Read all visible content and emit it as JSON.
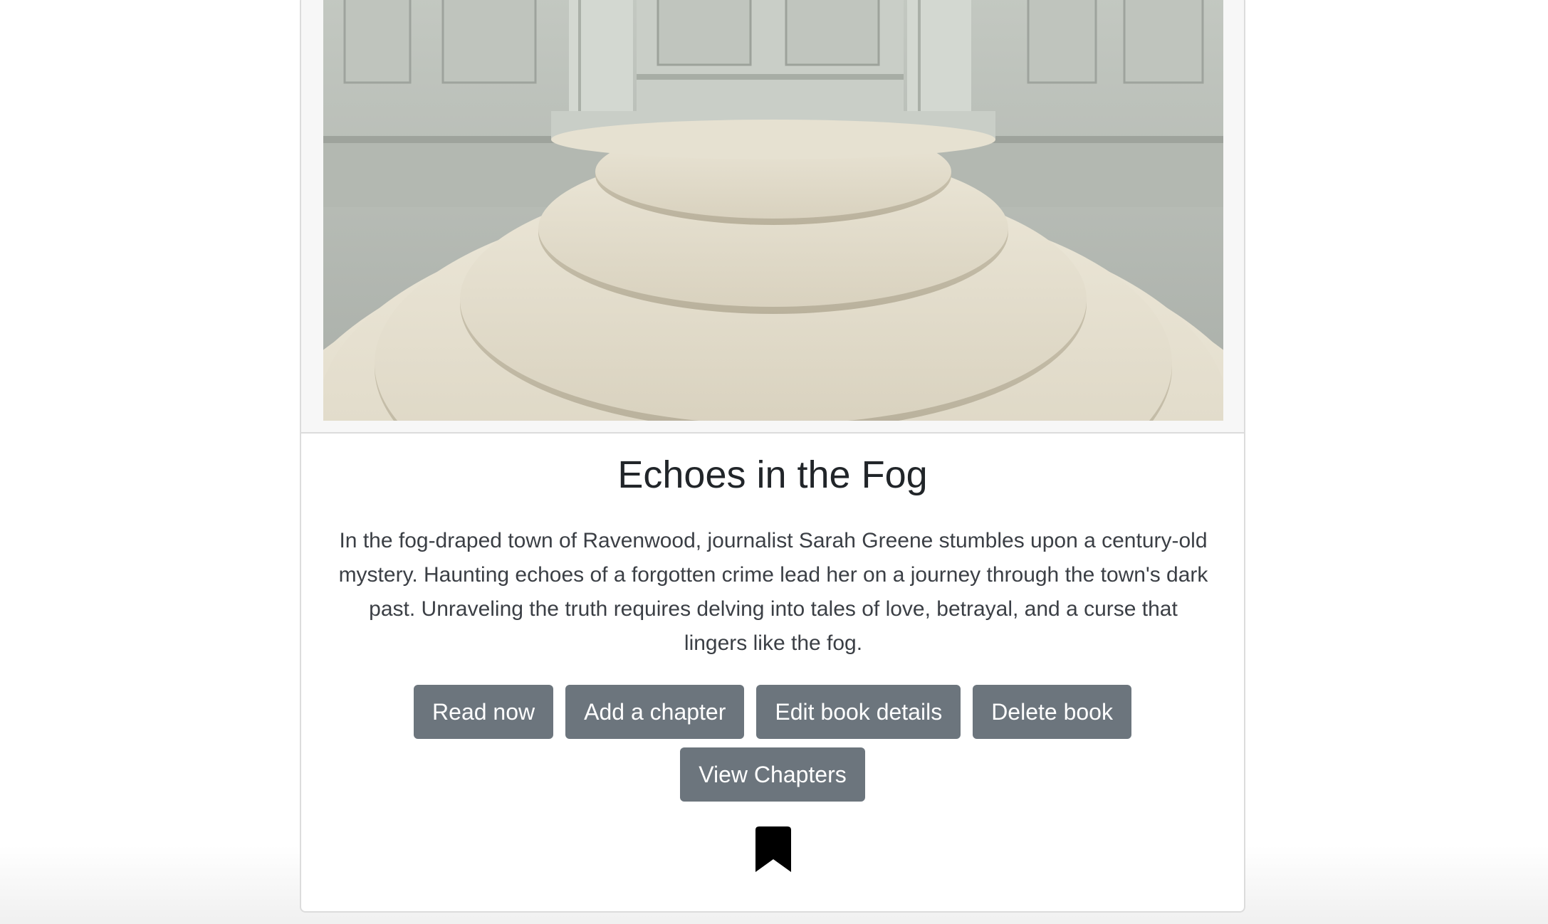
{
  "book": {
    "title": "Echoes in the Fog",
    "description": "In the fog-draped town of Ravenwood, journalist Sarah Greene stumbles upon a century-old mystery. Haunting echoes of a forgotten crime lead her on a journey through the town's dark past. Unraveling the truth requires delving into tales of love, betrayal, and a curse that lingers like the fog."
  },
  "actions": {
    "read_now": "Read now",
    "add_chapter": "Add a chapter",
    "edit_details": "Edit book details",
    "delete_book": "Delete book",
    "view_chapters": "View Chapters"
  },
  "icons": {
    "bookmark": "bookmark-icon",
    "cover": "marble-steps-image"
  },
  "colors": {
    "button_bg": "#6c757d",
    "button_text": "#ffffff",
    "title_text": "#212529",
    "body_text": "#3b3f45",
    "card_border": "#dcdcdc"
  }
}
